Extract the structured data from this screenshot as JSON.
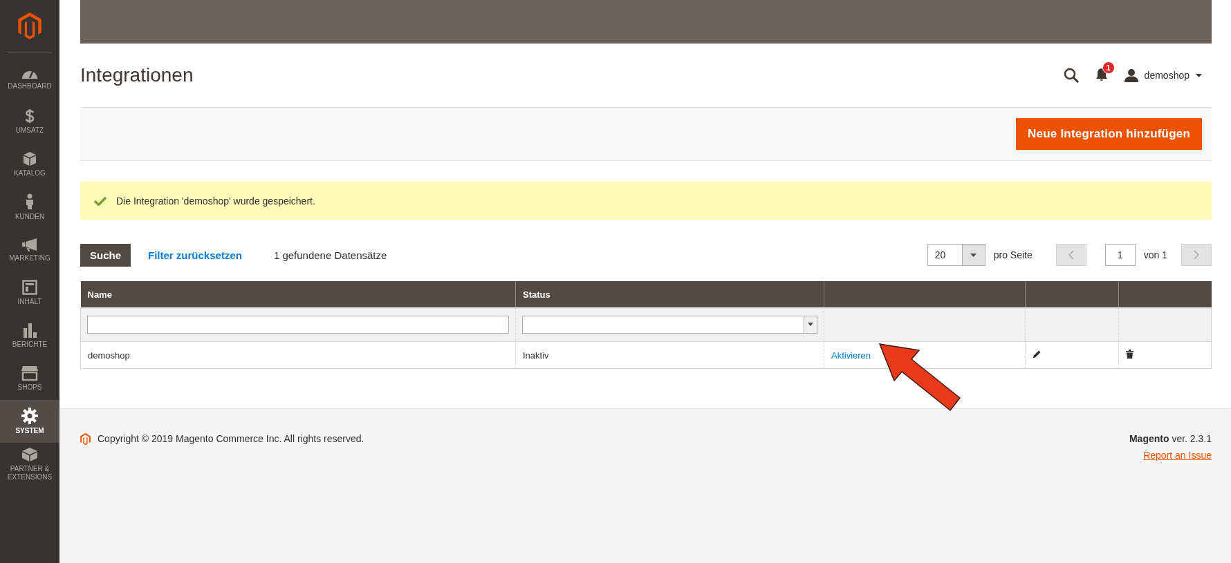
{
  "sidebar": {
    "items": [
      {
        "label": "DASHBOARD",
        "selected": false
      },
      {
        "label": "UMSATZ",
        "selected": false
      },
      {
        "label": "KATALOG",
        "selected": false
      },
      {
        "label": "KUNDEN",
        "selected": false
      },
      {
        "label": "MARKETING",
        "selected": false
      },
      {
        "label": "INHALT",
        "selected": false
      },
      {
        "label": "BERICHTE",
        "selected": false
      },
      {
        "label": "SHOPS",
        "selected": false
      },
      {
        "label": "SYSTEM",
        "selected": true
      },
      {
        "label": "PARTNER & EXTENSIONS",
        "selected": false
      }
    ]
  },
  "header": {
    "title": "Integrationen",
    "notification_count": "1",
    "user": "demoshop"
  },
  "actions": {
    "add_button": "Neue Integration hinzufügen"
  },
  "message": {
    "text": "Die Integration 'demoshop' wurde gespeichert."
  },
  "toolbar": {
    "search_button": "Suche",
    "reset_link": "Filter zurücksetzen",
    "records": "1 gefundene Datensätze",
    "per_page": "20",
    "per_page_label": "pro Seite",
    "page": "1",
    "page_total": "von 1"
  },
  "table": {
    "columns": [
      "Name",
      "Status"
    ],
    "rows": [
      {
        "name": "demoshop",
        "status": "Inaktiv",
        "action": "Aktivieren"
      }
    ]
  },
  "footer": {
    "copyright": "Copyright © 2019 Magento Commerce Inc. All rights reserved.",
    "version": "**Magento** ver. 2.3.1",
    "report_link": "Report an Issue"
  }
}
